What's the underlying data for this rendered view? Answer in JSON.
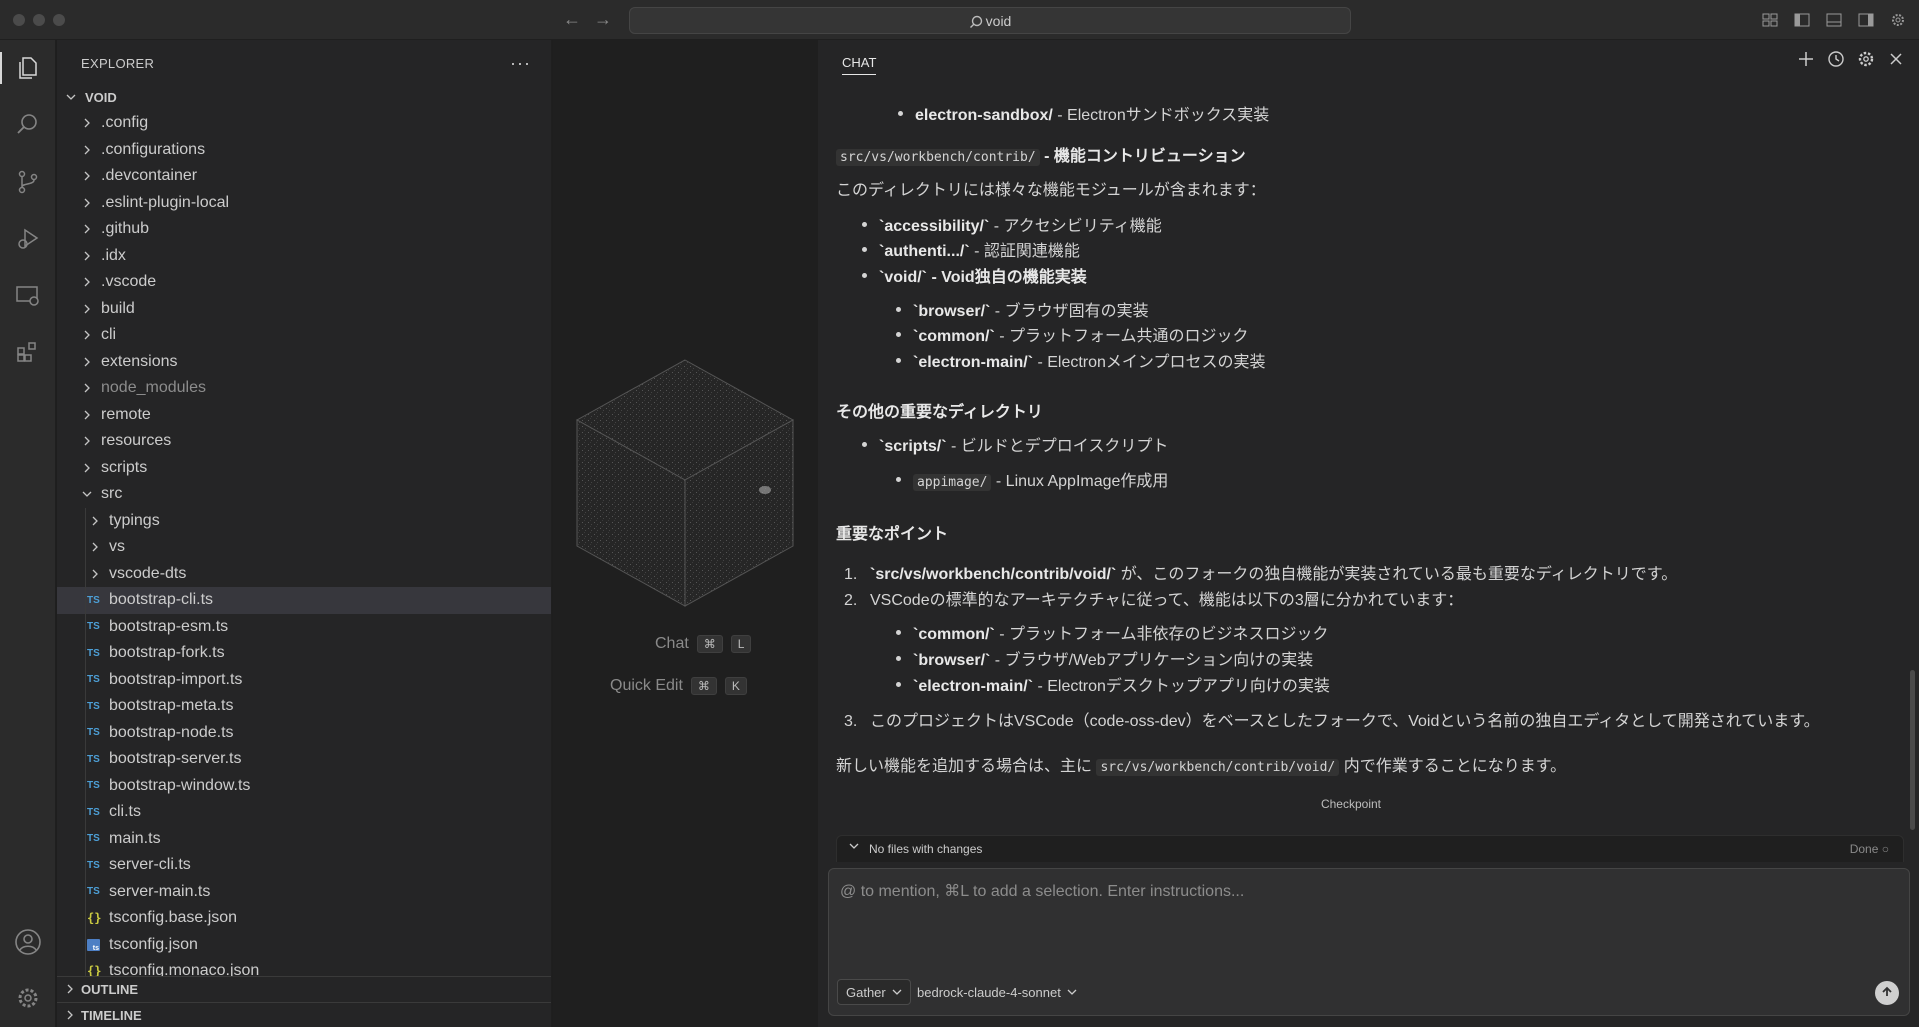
{
  "titlebar": {
    "search_text": "void"
  },
  "explorer": {
    "header": "EXPLORER",
    "more": "···",
    "root": "VOID",
    "items": [
      {
        "label": ".config",
        "kind": "folder"
      },
      {
        "label": ".configurations",
        "kind": "folder"
      },
      {
        "label": ".devcontainer",
        "kind": "folder"
      },
      {
        "label": ".eslint-plugin-local",
        "kind": "folder"
      },
      {
        "label": ".github",
        "kind": "folder"
      },
      {
        "label": ".idx",
        "kind": "folder"
      },
      {
        "label": ".vscode",
        "kind": "folder"
      },
      {
        "label": "build",
        "kind": "folder"
      },
      {
        "label": "cli",
        "kind": "folder"
      },
      {
        "label": "extensions",
        "kind": "folder"
      },
      {
        "label": "node_modules",
        "kind": "folder",
        "dim": true
      },
      {
        "label": "remote",
        "kind": "folder"
      },
      {
        "label": "resources",
        "kind": "folder"
      },
      {
        "label": "scripts",
        "kind": "folder"
      },
      {
        "label": "src",
        "kind": "folder-open"
      },
      {
        "label": "typings",
        "kind": "folder",
        "level": 2
      },
      {
        "label": "vs",
        "kind": "folder",
        "level": 2
      },
      {
        "label": "vscode-dts",
        "kind": "folder",
        "level": 2
      },
      {
        "label": "bootstrap-cli.ts",
        "kind": "ts",
        "level": 2,
        "selected": true
      },
      {
        "label": "bootstrap-esm.ts",
        "kind": "ts",
        "level": 2
      },
      {
        "label": "bootstrap-fork.ts",
        "kind": "ts",
        "level": 2
      },
      {
        "label": "bootstrap-import.ts",
        "kind": "ts",
        "level": 2
      },
      {
        "label": "bootstrap-meta.ts",
        "kind": "ts",
        "level": 2
      },
      {
        "label": "bootstrap-node.ts",
        "kind": "ts",
        "level": 2
      },
      {
        "label": "bootstrap-server.ts",
        "kind": "ts",
        "level": 2
      },
      {
        "label": "bootstrap-window.ts",
        "kind": "ts",
        "level": 2
      },
      {
        "label": "cli.ts",
        "kind": "ts",
        "level": 2
      },
      {
        "label": "main.ts",
        "kind": "ts",
        "level": 2
      },
      {
        "label": "server-cli.ts",
        "kind": "ts",
        "level": 2
      },
      {
        "label": "server-main.ts",
        "kind": "ts",
        "level": 2
      },
      {
        "label": "tsconfig.base.json",
        "kind": "json",
        "level": 2
      },
      {
        "label": "tsconfig.json",
        "kind": "tsjson",
        "level": 2
      },
      {
        "label": "tsconfig.monaco.json",
        "kind": "json",
        "level": 2
      }
    ],
    "outline": "OUTLINE",
    "timeline": "TIMELINE"
  },
  "editor": {
    "chat_label": "Chat",
    "chat_keys": [
      "⌘",
      "L"
    ],
    "quick_edit_label": "Quick Edit",
    "quick_edit_keys": [
      "⌘",
      "K"
    ]
  },
  "chat": {
    "title": "CHAT",
    "lines": {
      "l0_code": "electron-sandbox/",
      "l0_text": " - Electronサンドボックス実装",
      "l1_code": "src/vs/workbench/contrib/",
      "l1_text": " - 機能コントリビューション",
      "l2": "このディレクトリには様々な機能モジュールが含まれます：",
      "l3_b": "`accessibility/`",
      "l3_t": " - アクセシビリティ機能",
      "l4_b": "`authenti.../`",
      "l4_t": " - 認証関連機能",
      "l5_b": "`void/`",
      "l5_t": " - Void独自の機能実装",
      "l6_b": "`browser/`",
      "l6_t": " - ブラウザ固有の実装",
      "l7_b": "`common/`",
      "l7_t": " - プラットフォーム共通のロジック",
      "l8_b": "`electron-main/`",
      "l8_t": " - Electronメインプロセスの実装",
      "h1": "その他の重要なディレクトリ",
      "l9_b": "`scripts/`",
      "l9_t": " - ビルドとデプロイスクリプト",
      "l10_code": "appimage/",
      "l10_t": " - Linux AppImage作成用",
      "h2": "重要なポイント",
      "n1_num": "1.",
      "n1_b": "`src/vs/workbench/contrib/void/`",
      "n1_t": " が、このフォークの独自機能が実装されている最も重要なディレクトリです。",
      "n2_num": "2.",
      "n2_t": "VSCodeの標準的なアーキテクチャに従って、機能は以下の3層に分かれています：",
      "l11_b": "`common/`",
      "l11_t": " - プラットフォーム非依存のビジネスロジック",
      "l12_b": "`browser/`",
      "l12_t": " - ブラウザ/Webアプリケーション向けの実装",
      "l13_b": "`electron-main/`",
      "l13_t": " - Electronデスクトップアプリ向けの実装",
      "n3_num": "3.",
      "n3_t": "このプロジェクトはVSCode（code-oss-dev）をベースとしたフォークで、Voidという名前の独自エディタとして開発されています。",
      "l14_a": "新しい機能を追加する場合は、主に ",
      "l14_code": "src/vs/workbench/contrib/void/",
      "l14_b": " 内で作業することになります。"
    },
    "checkpoint": "Checkpoint",
    "changes_label": "No files with changes",
    "done_label": "Done",
    "input_placeholder": "@ to mention, ⌘L to add a selection. Enter instructions...",
    "mode": "Gather",
    "model": "bedrock-claude-4-sonnet"
  },
  "colors": {
    "accent_ts": "#4d9fd6",
    "json": "#cbcb41",
    "background": "#1e1e1e"
  }
}
